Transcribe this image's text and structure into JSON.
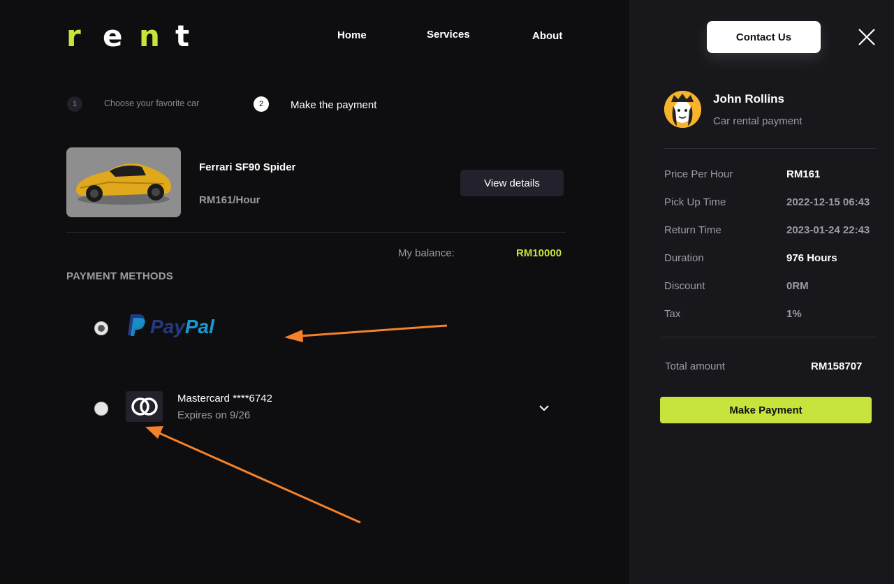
{
  "brand": {
    "letters": [
      "r",
      "e",
      "n",
      "t"
    ],
    "accent": "#c6e43c"
  },
  "nav": {
    "home": "Home",
    "services": "Services",
    "about": "About",
    "contact": "Contact Us"
  },
  "steps": [
    {
      "num": "1",
      "label": "Choose your favorite car"
    },
    {
      "num": "2",
      "label": "Make the payment"
    }
  ],
  "car": {
    "name": "Ferrari SF90 Spider",
    "price": "RM161/Hour",
    "details_label": "View details"
  },
  "balance": {
    "label": "My balance:",
    "value": "RM10000"
  },
  "payment": {
    "title": "PAYMENT METHODS",
    "paypal": {
      "text_a": "Pay",
      "text_b": "Pal",
      "selected": true
    },
    "mastercard": {
      "name": "Mastercard ****6742",
      "expires": "Expires on 9/26",
      "selected": false
    }
  },
  "user": {
    "name": "John Rollins",
    "subtitle": "Car rental payment"
  },
  "summary": [
    {
      "label": "Price Per Hour",
      "value": "RM161",
      "color": "#ffffff"
    },
    {
      "label": "Pick Up Time",
      "value": "2022-12-15 06:43",
      "color": "#9c9ba3"
    },
    {
      "label": "Return Time",
      "value": "2023-01-24 22:43",
      "color": "#9c9ba3"
    },
    {
      "label": "Duration",
      "value": "976 Hours",
      "color": "#ffffff"
    },
    {
      "label": "Discount",
      "value": "0RM",
      "color": "#9c9ba3"
    },
    {
      "label": "Tax",
      "value": "1%",
      "color": "#9c9ba3"
    }
  ],
  "total": {
    "label": "Total amount",
    "value": "RM158707"
  },
  "pay_button": "Make Payment",
  "annotation_color": "#f5822a"
}
